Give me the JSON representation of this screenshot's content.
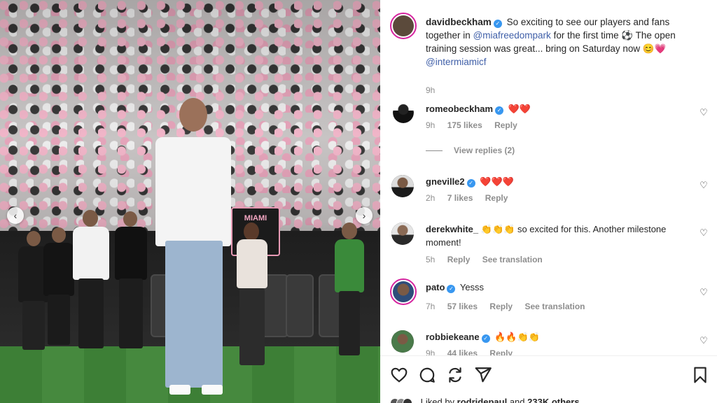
{
  "post": {
    "caption": {
      "username": "davidbeckham",
      "text_1": "So exciting to see our players and fans together in",
      "mention_1": "@miafreedompark",
      "text_2": "for the first time ⚽ The open training session was great... bring on Saturday now 😊💗",
      "mention_2": "@intermiamicf",
      "time": "9h"
    },
    "photo": {
      "banner_text": "MIAMI"
    }
  },
  "comments": [
    {
      "username": "romeobeckham",
      "verified": true,
      "text": "❤️❤️",
      "time": "9h",
      "likes": "175 likes",
      "reply": "Reply",
      "translation": ""
    },
    {
      "username": "gneville2",
      "verified": true,
      "text": "❤️❤️❤️",
      "time": "2h",
      "likes": "7 likes",
      "reply": "Reply",
      "translation": ""
    },
    {
      "username": "derekwhite_",
      "verified": false,
      "text": "👏👏👏 so excited for this. Another milestone moment!",
      "time": "5h",
      "likes": "",
      "reply": "Reply",
      "translation": "See translation"
    },
    {
      "username": "pato",
      "verified": true,
      "text": "Yesss",
      "time": "7h",
      "likes": "57 likes",
      "reply": "Reply",
      "translation": "See translation"
    },
    {
      "username": "robbiekeane",
      "verified": true,
      "text": "🔥🔥👏👏",
      "time": "9h",
      "likes": "44 likes",
      "reply": "Reply",
      "translation": ""
    }
  ],
  "view_replies": "View replies (2)",
  "liked_by": {
    "prefix": "Liked by",
    "user": "rodridepaul",
    "middle": "and",
    "count": "233K others"
  },
  "colors": {
    "verified": "#3897f0",
    "mention": "#3f5fa8",
    "story_ring": "#d6249f",
    "meta": "#8e8e8e"
  },
  "icons": [
    "heart-icon",
    "comment-icon",
    "share-icon",
    "send-icon",
    "bookmark-icon",
    "chevron-left-icon",
    "chevron-right-icon",
    "verified-icon"
  ]
}
